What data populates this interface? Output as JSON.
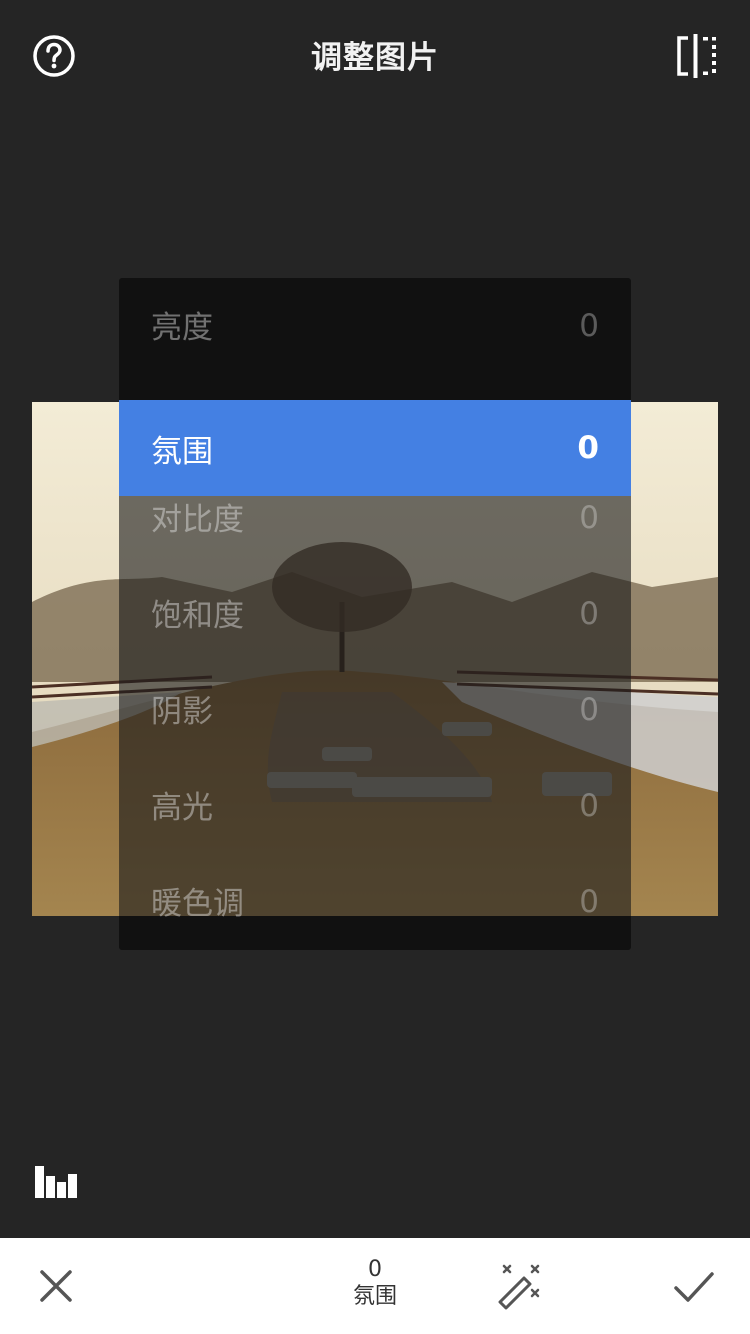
{
  "header": {
    "title": "调整图片",
    "help_icon": "help-circle-icon",
    "compare_icon": "compare-split-icon"
  },
  "menu": {
    "items": [
      {
        "label": "亮度",
        "value": "0",
        "selected": false
      },
      {
        "label": "氛围",
        "value": "0",
        "selected": true
      },
      {
        "label": "对比度",
        "value": "0",
        "selected": false
      },
      {
        "label": "饱和度",
        "value": "0",
        "selected": false
      },
      {
        "label": "阴影",
        "value": "0",
        "selected": false
      },
      {
        "label": "高光",
        "value": "0",
        "selected": false
      },
      {
        "label": "暖色调",
        "value": "0",
        "selected": false
      }
    ]
  },
  "bottom_bar": {
    "current_value": "0",
    "current_name": "氛围",
    "cancel_icon": "close-icon",
    "auto_icon": "magic-wand-icon",
    "apply_icon": "checkmark-icon"
  },
  "histogram_icon": "histogram-icon",
  "colors": {
    "background": "#252525",
    "accent": "#4480e3",
    "bottom_bar": "#ffffff"
  }
}
